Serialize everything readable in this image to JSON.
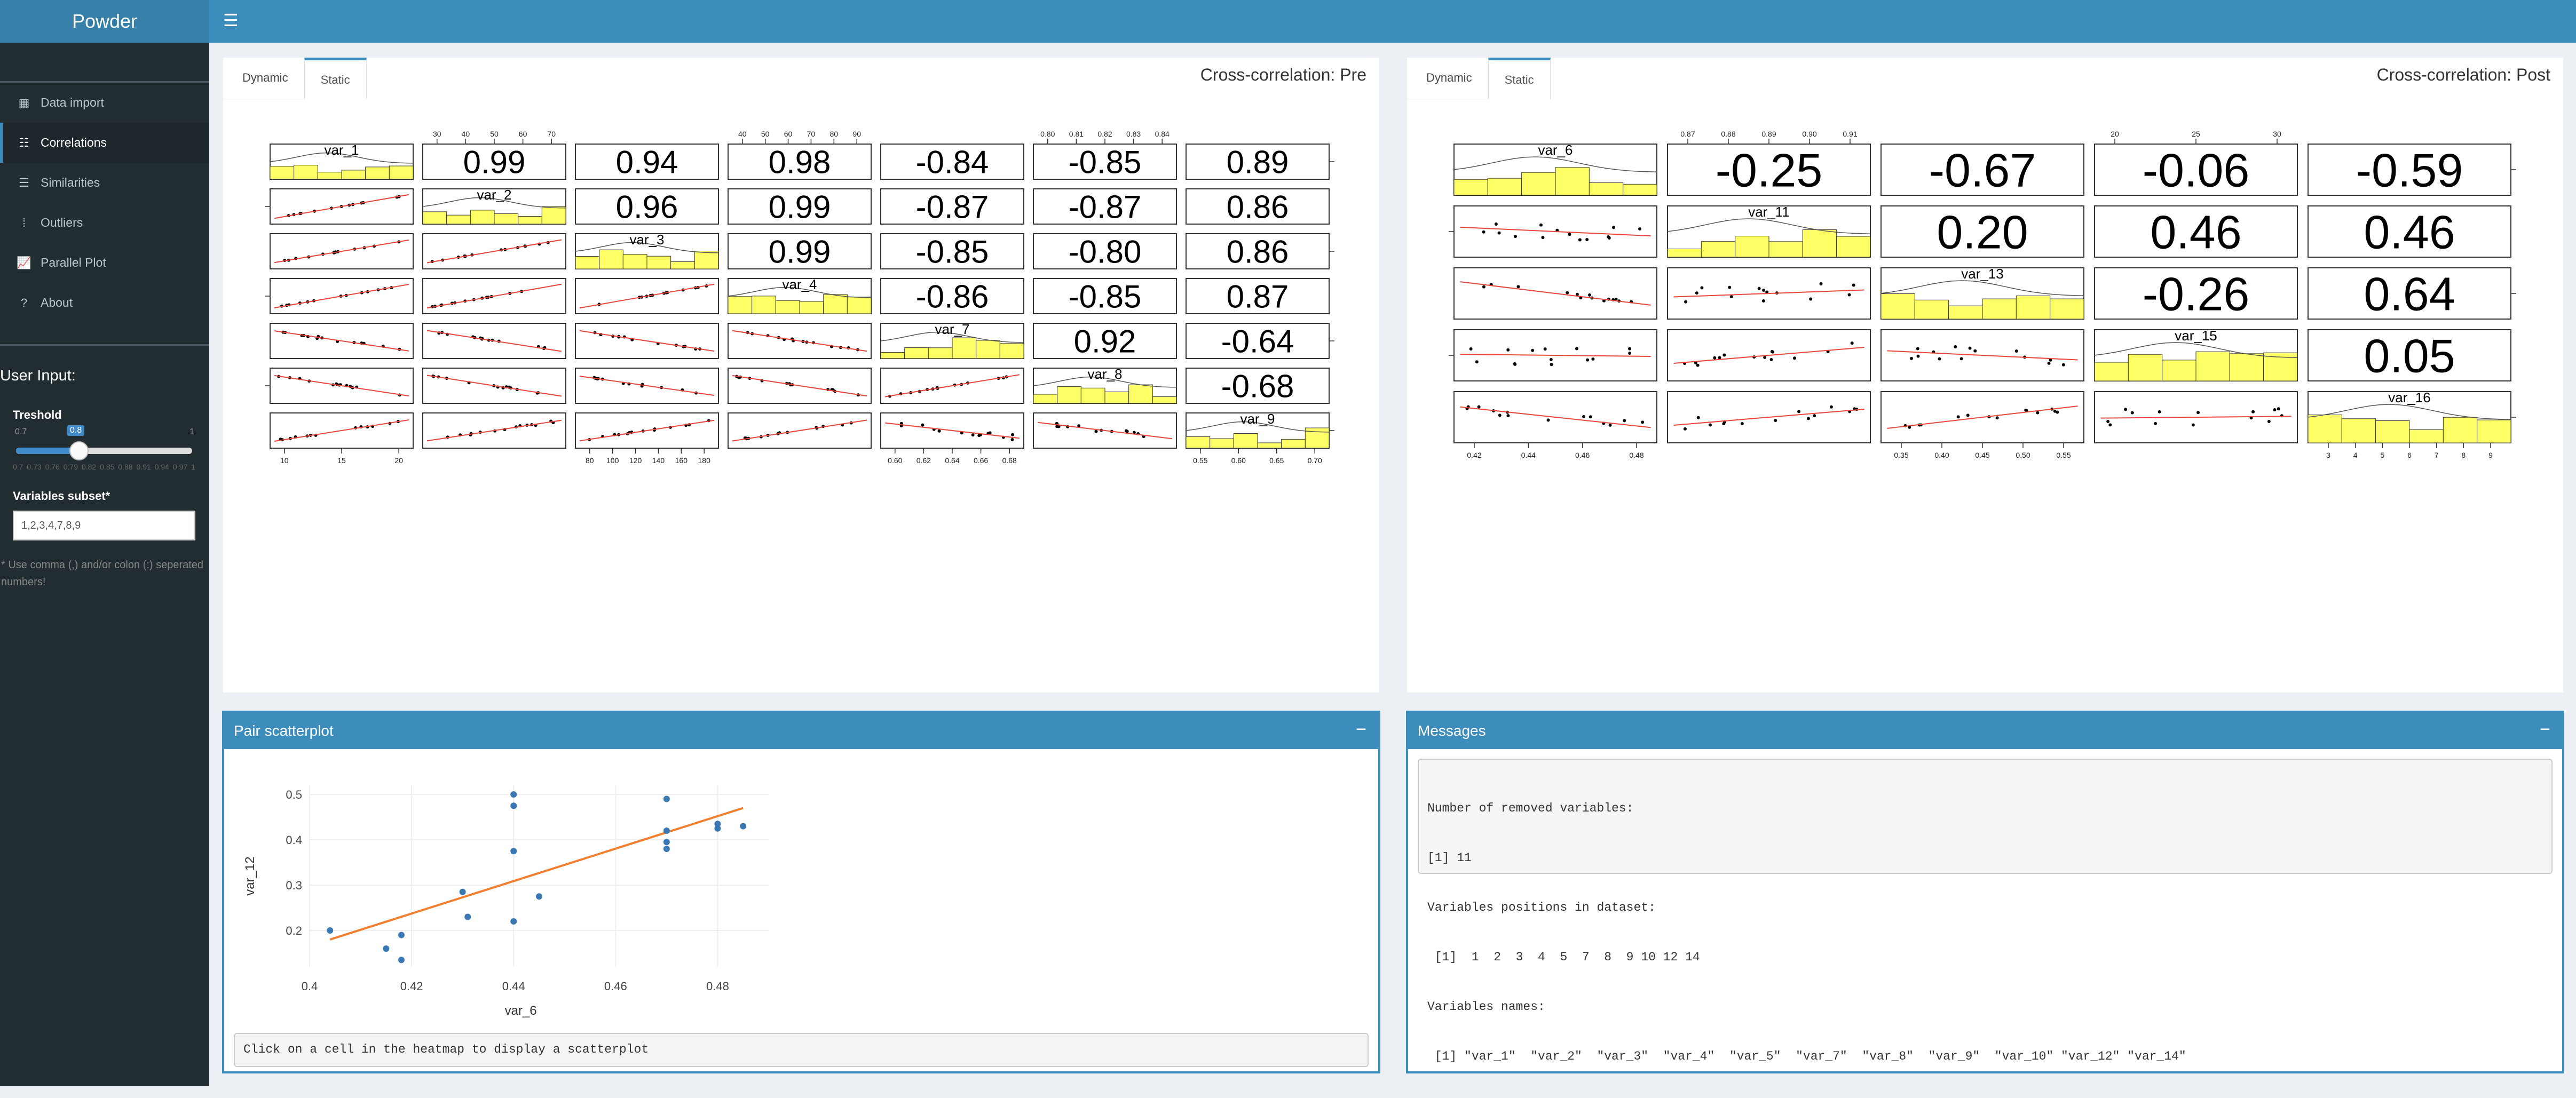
{
  "app": {
    "title": "Powder"
  },
  "sidebar": {
    "items": [
      {
        "label": "Data import",
        "icon": "table-icon"
      },
      {
        "label": "Correlations",
        "icon": "bars-icon"
      },
      {
        "label": "Similarities",
        "icon": "list-icon"
      },
      {
        "label": "Outliers",
        "icon": "dots-icon"
      },
      {
        "label": "Parallel Plot",
        "icon": "line-chart-icon"
      },
      {
        "label": "About",
        "icon": "question-icon"
      }
    ],
    "user_input_title": "User Input:",
    "threshold": {
      "label": "Treshold",
      "min": "0.7",
      "max": "1",
      "value": "0.8",
      "ticks": [
        "0.7",
        "0.73",
        "0.76",
        "0.79",
        "0.82",
        "0.85",
        "0.88",
        "0.91",
        "0.94",
        "0.97",
        "1"
      ]
    },
    "subset": {
      "label": "Variables subset*",
      "value": "1,2,3,4,7,8,9",
      "hint": "* Use comma (,) and/or colon (:) seperated numbers!"
    }
  },
  "colors": {
    "header": "#3c8dbc",
    "logo": "#367fa9",
    "sidebar": "#222d32",
    "hist": "#ffff66",
    "fit": "#e8453c",
    "scatter_point": "#3a78b4",
    "scatter_line": "#f08030"
  },
  "pre": {
    "tabs": [
      "Dynamic",
      "Static"
    ],
    "title": "Cross-correlation: Pre",
    "chart_data": {
      "type": "table",
      "variables": [
        "var_1",
        "var_2",
        "var_3",
        "var_4",
        "var_7",
        "var_8",
        "var_9"
      ],
      "correlations": [
        [
          "var_1",
          "var_2",
          "0.99"
        ],
        [
          "var_1",
          "var_3",
          "0.94"
        ],
        [
          "var_1",
          "var_4",
          "0.98"
        ],
        [
          "var_1",
          "var_7",
          "-0.84"
        ],
        [
          "var_1",
          "var_8",
          "-0.85"
        ],
        [
          "var_1",
          "var_9",
          "0.89"
        ],
        [
          "var_2",
          "var_3",
          "0.96"
        ],
        [
          "var_2",
          "var_4",
          "0.99"
        ],
        [
          "var_2",
          "var_7",
          "-0.87"
        ],
        [
          "var_2",
          "var_8",
          "-0.87"
        ],
        [
          "var_2",
          "var_9",
          "0.86"
        ],
        [
          "var_3",
          "var_4",
          "0.99"
        ],
        [
          "var_3",
          "var_7",
          "-0.85"
        ],
        [
          "var_3",
          "var_8",
          "-0.80"
        ],
        [
          "var_3",
          "var_9",
          "0.86"
        ],
        [
          "var_4",
          "var_7",
          "-0.86"
        ],
        [
          "var_4",
          "var_8",
          "-0.85"
        ],
        [
          "var_4",
          "var_9",
          "0.87"
        ],
        [
          "var_7",
          "var_8",
          "0.92"
        ],
        [
          "var_7",
          "var_9",
          "-0.64"
        ],
        [
          "var_8",
          "var_9",
          "-0.68"
        ]
      ],
      "top_axis": [
        [
          "30",
          "40",
          "50",
          "60",
          "70"
        ],
        [
          "40",
          "50",
          "60",
          "70",
          "80",
          "90"
        ],
        [
          "0.80",
          "0.81",
          "0.82",
          "0.83",
          "0.84"
        ]
      ],
      "bottom_axis": [
        [
          "10",
          "15",
          "20"
        ],
        [
          "80",
          "100",
          "120",
          "140",
          "160",
          "180"
        ],
        [
          "0.60",
          "0.62",
          "0.64",
          "0.66",
          "0.68"
        ],
        [
          "0.55",
          "0.60",
          "0.65",
          "0.70"
        ]
      ]
    }
  },
  "post": {
    "tabs": [
      "Dynamic",
      "Static"
    ],
    "title": "Cross-correlation: Post",
    "chart_data": {
      "type": "table",
      "variables": [
        "var_6",
        "var_11",
        "var_13",
        "var_15",
        "var_16"
      ],
      "correlations": [
        [
          "var_6",
          "var_11",
          "-0.25"
        ],
        [
          "var_6",
          "var_13",
          "-0.67"
        ],
        [
          "var_6",
          "var_15",
          "-0.06"
        ],
        [
          "var_6",
          "var_16",
          "-0.59"
        ],
        [
          "var_11",
          "var_13",
          "0.20"
        ],
        [
          "var_11",
          "var_15",
          "0.46"
        ],
        [
          "var_11",
          "var_16",
          "0.46"
        ],
        [
          "var_13",
          "var_15",
          "-0.26"
        ],
        [
          "var_13",
          "var_16",
          "0.64"
        ],
        [
          "var_15",
          "var_16",
          "0.05"
        ]
      ],
      "top_axis": [
        [
          "0.87",
          "0.88",
          "0.89",
          "0.90",
          "0.91"
        ],
        [
          "20",
          "25",
          "30"
        ]
      ],
      "bottom_axis": [
        [
          "0.42",
          "0.44",
          "0.46",
          "0.48"
        ],
        [
          "0.35",
          "0.40",
          "0.45",
          "0.50",
          "0.55"
        ],
        [
          "3",
          "4",
          "5",
          "6",
          "7",
          "8",
          "9"
        ]
      ]
    }
  },
  "pair": {
    "title": "Pair scatterplot",
    "minimize": "−",
    "caption": "Click on a cell in the heatmap to display a scatterplot",
    "chart_data": {
      "type": "scatter",
      "xlabel": "var_6",
      "ylabel": "var_12",
      "xlim": [
        0.4,
        0.49
      ],
      "ylim": [
        0.12,
        0.52
      ],
      "xticks": [
        "0.4",
        "0.42",
        "0.44",
        "0.46",
        "0.48"
      ],
      "yticks": [
        "0.2",
        "0.3",
        "0.4",
        "0.5"
      ],
      "x": [
        0.404,
        0.415,
        0.418,
        0.418,
        0.43,
        0.431,
        0.44,
        0.44,
        0.44,
        0.44,
        0.445,
        0.47,
        0.47,
        0.47,
        0.47,
        0.48,
        0.48,
        0.485
      ],
      "y": [
        0.2,
        0.16,
        0.19,
        0.135,
        0.285,
        0.23,
        0.5,
        0.475,
        0.375,
        0.22,
        0.275,
        0.49,
        0.42,
        0.395,
        0.38,
        0.435,
        0.425,
        0.43
      ],
      "fit": {
        "x": [
          0.404,
          0.485
        ],
        "y": [
          0.18,
          0.47
        ]
      }
    }
  },
  "messages": {
    "title": "Messages",
    "minimize": "−",
    "lines": [
      "Number of removed variables:",
      "[1] 11",
      "Variables positions in dataset:",
      " [1]  1  2  3  4  5  7  8  9 10 12 14",
      "Variables names:",
      " [1] \"var_1\"  \"var_2\"  \"var_3\"  \"var_4\"  \"var_5\"  \"var_7\"  \"var_8\"  \"var_9\"  \"var_10\" \"var_12\" \"var_14\""
    ]
  }
}
